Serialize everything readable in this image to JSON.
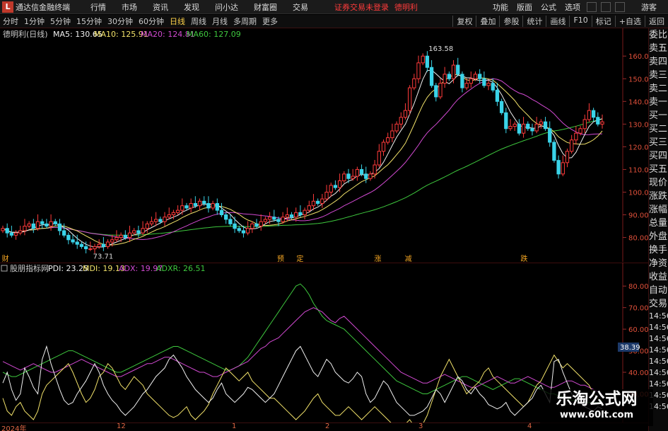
{
  "titlebar": {
    "logo": "L",
    "app_title": "通达信金融终端",
    "menu": [
      "行情",
      "市场",
      "资讯",
      "发现",
      "问小达",
      "财富圈",
      "交易"
    ],
    "notice": "证券交易未登录",
    "stock": "德明利",
    "right": [
      "功能",
      "版面",
      "公式",
      "选项"
    ],
    "guest": "游客"
  },
  "toolbar": {
    "timeframes": [
      "分时",
      "1分钟",
      "5分钟",
      "15分钟",
      "30分钟",
      "60分钟",
      "日线",
      "周线",
      "月线",
      "多周期",
      "更多"
    ],
    "active": "日线",
    "right_buttons": [
      "复权",
      "叠加",
      "参股",
      "统计",
      "画线",
      "F10",
      "标记",
      "+自选",
      "返回"
    ]
  },
  "main": {
    "title": "德明利(日线)",
    "ma": [
      {
        "label": "MA5: 130.65",
        "color": "#f0f0f0"
      },
      {
        "label": "MA10: 125.91",
        "color": "#f2e26a"
      },
      {
        "label": "MA20: 124.81",
        "color": "#d24ad2"
      },
      {
        "label": "MA60: 127.09",
        "color": "#3ec83e"
      }
    ],
    "yticks": [
      "160.0",
      "150.0",
      "140.0",
      "130.0",
      "120.0",
      "110.0",
      "100.0",
      "90.00",
      "80.00"
    ],
    "high_label": "163.58",
    "low_label": "73.71",
    "markers": [
      {
        "t": "预",
        "x": 0.445
      },
      {
        "t": "定",
        "x": 0.476
      },
      {
        "t": "涨",
        "x": 0.601
      },
      {
        "t": "减",
        "x": 0.65
      },
      {
        "t": "跌",
        "x": 0.836
      },
      {
        "t": "财",
        "x": 0.003
      }
    ]
  },
  "indicator": {
    "title": "股朋指标网",
    "pdi": "PDI: 23.25",
    "mdi": "MDI: 19.13",
    "adx": "ADX: 19.97",
    "adxr": "ADXR: 26.51",
    "yticks": [
      "80.00",
      "70.00",
      "60.00",
      "50.00",
      "40.00",
      "30.00"
    ],
    "cursor_val": "38.39"
  },
  "dates": [
    "2024年",
    "12",
    "1",
    "2",
    "3",
    "4"
  ],
  "rp": {
    "items": [
      "委比",
      "卖五",
      "卖四",
      "卖三",
      "卖二",
      "卖一",
      "买一",
      "买二",
      "买三",
      "买四",
      "买五",
      "现价",
      "涨跌",
      "涨幅",
      "总量",
      "外盘",
      "换手",
      "净资",
      "收益",
      "自动",
      "交易"
    ],
    "times": [
      "14:56",
      "14:56",
      "14:56",
      "14:56",
      "14:56",
      "14:56",
      "14:56",
      "14:56",
      "14:56"
    ]
  },
  "watermark": {
    "a": "乐淘公式网",
    "b": "www.60lt.com"
  },
  "chart_data": {
    "type": "candlestick",
    "ylim": [
      73,
      166
    ],
    "close": [
      84,
      82,
      81,
      82,
      83,
      85,
      86,
      84,
      87,
      86,
      85,
      87,
      86,
      83,
      81,
      79,
      78,
      77,
      76,
      75,
      75,
      76,
      77,
      76,
      78,
      79,
      80,
      81,
      80,
      82,
      83,
      82,
      84,
      86,
      87,
      88,
      87,
      89,
      90,
      91,
      92,
      94,
      93,
      95,
      94,
      96,
      95,
      93,
      95,
      92,
      90,
      88,
      86,
      84,
      83,
      82,
      84,
      86,
      85,
      87,
      88,
      89,
      88,
      87,
      89,
      90,
      89,
      91,
      90,
      92,
      94,
      96,
      95,
      97,
      100,
      103,
      102,
      105,
      108,
      106,
      107,
      110,
      108,
      106,
      108,
      112,
      118,
      122,
      124,
      127,
      130,
      133,
      136,
      146,
      150,
      157,
      160,
      155,
      147,
      142,
      148,
      152,
      150,
      156,
      152,
      146,
      148,
      150,
      152,
      150,
      147,
      148,
      145,
      140,
      135,
      128,
      129,
      130,
      126,
      130,
      128,
      127,
      130,
      131,
      128,
      122,
      114,
      108,
      113,
      118,
      123,
      126,
      128,
      132,
      136,
      133,
      130,
      131
    ]
  },
  "indicator_data": {
    "type": "line",
    "ylim": [
      18,
      85
    ],
    "pdi": [
      35,
      40,
      32,
      27,
      30,
      42,
      38,
      33,
      30,
      46,
      52,
      44,
      38,
      32,
      27,
      25,
      26,
      30,
      33,
      36,
      40,
      44,
      40,
      34,
      30,
      27,
      25,
      22,
      20,
      22,
      24,
      27,
      30,
      32,
      35,
      38,
      40,
      42,
      46,
      48,
      45,
      42,
      38,
      35,
      32,
      30,
      28,
      26,
      28,
      32,
      35,
      30,
      28,
      26,
      28,
      30,
      33,
      32,
      30,
      28,
      26,
      28,
      30,
      34,
      38,
      42,
      46,
      50,
      52,
      48,
      44,
      40,
      38,
      42,
      46,
      44,
      40,
      38,
      36,
      35,
      37,
      40,
      38,
      30,
      26,
      28,
      32,
      36,
      34,
      30,
      26,
      24,
      22,
      20,
      20,
      21,
      22,
      24,
      28,
      32,
      30,
      26,
      30,
      34,
      38,
      36,
      32,
      30,
      33,
      30,
      28,
      25,
      24,
      23,
      24,
      26,
      22,
      20,
      22,
      24,
      26,
      28,
      32,
      34,
      30,
      26,
      45,
      46,
      40,
      35,
      30,
      28,
      26,
      24,
      23,
      22,
      24,
      23
    ],
    "mdi": [
      28,
      22,
      20,
      24,
      26,
      22,
      20,
      18,
      22,
      30,
      34,
      36,
      38,
      40,
      42,
      44,
      40,
      35,
      30,
      26,
      28,
      32,
      38,
      40,
      44,
      42,
      38,
      34,
      32,
      35,
      38,
      36,
      34,
      30,
      28,
      26,
      24,
      22,
      20,
      19,
      20,
      22,
      24,
      20,
      18,
      20,
      22,
      25,
      30,
      34,
      38,
      42,
      40,
      38,
      36,
      38,
      40,
      36,
      34,
      32,
      30,
      28,
      28,
      26,
      24,
      22,
      20,
      18,
      20,
      22,
      25,
      28,
      30,
      26,
      24,
      22,
      20,
      20,
      22,
      24,
      22,
      20,
      18,
      20,
      22,
      24,
      22,
      20,
      18,
      16,
      15,
      14,
      16,
      18,
      15,
      14,
      16,
      20,
      26,
      32,
      38,
      42,
      46,
      42,
      38,
      34,
      30,
      32,
      34,
      36,
      40,
      42,
      38,
      36,
      34,
      32,
      30,
      28,
      26,
      24,
      26,
      30,
      34,
      36,
      40,
      44,
      48,
      45,
      42,
      44,
      42,
      40,
      38,
      36,
      34,
      30,
      28,
      25
    ],
    "adx": [
      45,
      44,
      43,
      42,
      41,
      42,
      43,
      44,
      43,
      42,
      41,
      40,
      40,
      41,
      42,
      43,
      44,
      45,
      46,
      45,
      44,
      43,
      42,
      41,
      40,
      39,
      38,
      38,
      39,
      40,
      41,
      42,
      43,
      44,
      44,
      45,
      46,
      47,
      47,
      46,
      45,
      44,
      43,
      42,
      41,
      40,
      40,
      39,
      38,
      38,
      39,
      40,
      41,
      42,
      43,
      44,
      45,
      47,
      49,
      51,
      52,
      54,
      55,
      56,
      58,
      60,
      62,
      64,
      66,
      68,
      69,
      70,
      69,
      68,
      66,
      64,
      63,
      65,
      66,
      64,
      62,
      60,
      58,
      56,
      54,
      52,
      50,
      48,
      46,
      44,
      42,
      40,
      39,
      38,
      37,
      36,
      35,
      35,
      36,
      37,
      38,
      39,
      38,
      37,
      36,
      35,
      34,
      33,
      33,
      34,
      35,
      36,
      37,
      38,
      37,
      36,
      35,
      35,
      36,
      37,
      38,
      37,
      36,
      35,
      34,
      33,
      33,
      34,
      35,
      36,
      36,
      35,
      34,
      34,
      33,
      32,
      31,
      30
    ],
    "adxr": [
      40,
      39,
      38,
      38,
      39,
      40,
      41,
      42,
      43,
      44,
      45,
      46,
      47,
      48,
      49,
      50,
      50,
      49,
      48,
      47,
      46,
      45,
      44,
      43,
      42,
      41,
      40,
      40,
      41,
      42,
      43,
      44,
      45,
      46,
      47,
      48,
      49,
      50,
      51,
      52,
      52,
      51,
      50,
      49,
      48,
      47,
      46,
      45,
      44,
      43,
      42,
      41,
      41,
      42,
      43,
      45,
      47,
      50,
      53,
      56,
      59,
      62,
      65,
      68,
      71,
      74,
      77,
      80,
      81,
      79,
      76,
      72,
      69,
      66,
      64,
      63,
      62,
      61,
      60,
      58,
      56,
      54,
      52,
      50,
      48,
      46,
      44,
      42,
      40,
      38,
      36,
      35,
      34,
      33,
      32,
      31,
      30,
      30,
      31,
      32,
      33,
      34,
      35,
      36,
      37,
      38,
      38,
      37,
      36,
      35,
      34,
      33,
      32,
      33,
      34,
      35,
      36,
      37,
      37,
      36,
      35,
      34,
      33,
      32,
      31,
      30,
      30,
      29,
      29,
      28,
      27,
      27,
      26,
      26,
      26,
      26,
      26,
      27
    ]
  }
}
